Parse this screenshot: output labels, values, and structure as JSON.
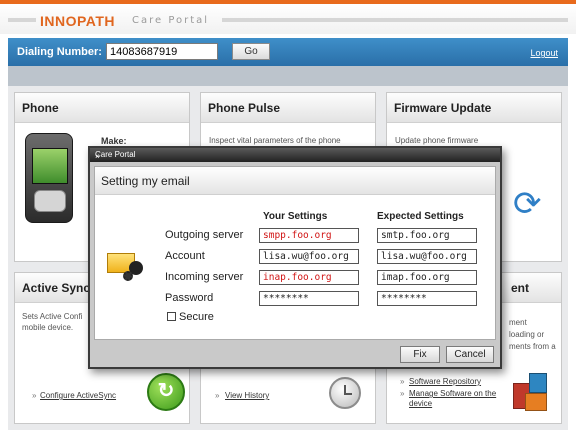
{
  "header": {
    "logo_brand": "INNOPATH",
    "logo_subtitle": "Care Portal"
  },
  "dial": {
    "label": "Dialing Number:",
    "value": "14083687919",
    "go_label": "Go",
    "logout_label": "Logout"
  },
  "panels": {
    "phone": {
      "title": "Phone",
      "make_label": "Make:"
    },
    "phone_pulse": {
      "title": "Phone Pulse",
      "description": "Inspect vital parameters of the phone",
      "link": "View History"
    },
    "firmware": {
      "title": "Firmware Update",
      "description": "Update phone firmware"
    },
    "active_sync": {
      "title": "Active Sync",
      "description_1": "Sets Active Confi",
      "description_2": "mobile device.",
      "link": "Configure ActiveSync"
    },
    "software": {
      "title_fragment": "ent",
      "text_1": "ment",
      "text_2": "loading or",
      "text_3": "ments from a",
      "link_1": "Software Repository",
      "link_2a": "Manage Software on the",
      "link_2b": "device"
    }
  },
  "dialog": {
    "window_title": "Care Portal",
    "close_symbol": "×",
    "heading": "Setting my email",
    "col_your": "Your Settings",
    "col_expected": "Expected Settings",
    "rows": [
      {
        "label": "Outgoing server",
        "yours": "smpp.foo.org",
        "expected": "smtp.foo.org",
        "mismatch": true
      },
      {
        "label": "Account",
        "yours": "lisa.wu@foo.org",
        "expected": "lisa.wu@foo.org",
        "mismatch": false
      },
      {
        "label": "Incoming server",
        "yours": "inap.foo.org",
        "expected": "imap.foo.org",
        "mismatch": true
      },
      {
        "label": "Password",
        "yours": "********",
        "expected": "********",
        "mismatch": false
      }
    ],
    "secure_label": "Secure",
    "secure_checked": false,
    "fix_label": "Fix",
    "cancel_label": "Cancel"
  },
  "colors": {
    "brand_orange": "#e0661f",
    "dial_bar_blue": "#3f8fc9",
    "mismatch_red": "#d11515",
    "sync_green": "#3c9a1a",
    "refresh_blue": "#2f7fc6"
  },
  "icons": [
    "phone-device-icon",
    "refresh-icon",
    "sync-icon",
    "clock-icon",
    "software-boxes-icon",
    "mail-gear-icon",
    "close-icon"
  ]
}
